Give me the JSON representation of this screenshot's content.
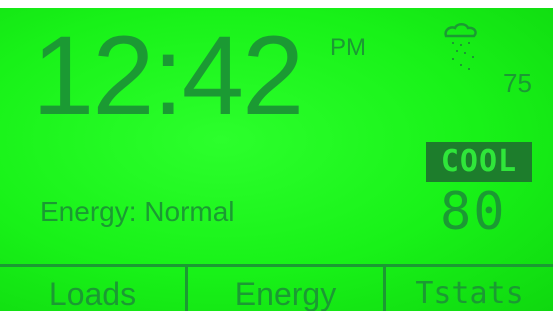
{
  "display": {
    "time": "12:42",
    "meridiem": "PM",
    "weather": {
      "icon": "cloud-rain-icon",
      "outdoor_temp": "75"
    },
    "energy_status": "Energy: Normal",
    "mode": "COOL",
    "setpoint": "80"
  },
  "softkeys": [
    {
      "label": "Loads"
    },
    {
      "label": "Energy"
    },
    {
      "label": "Tstats"
    }
  ],
  "colors": {
    "backlight": "#18f218",
    "segment": "#1b9a33",
    "badge_bg": "#1d7d2c"
  }
}
